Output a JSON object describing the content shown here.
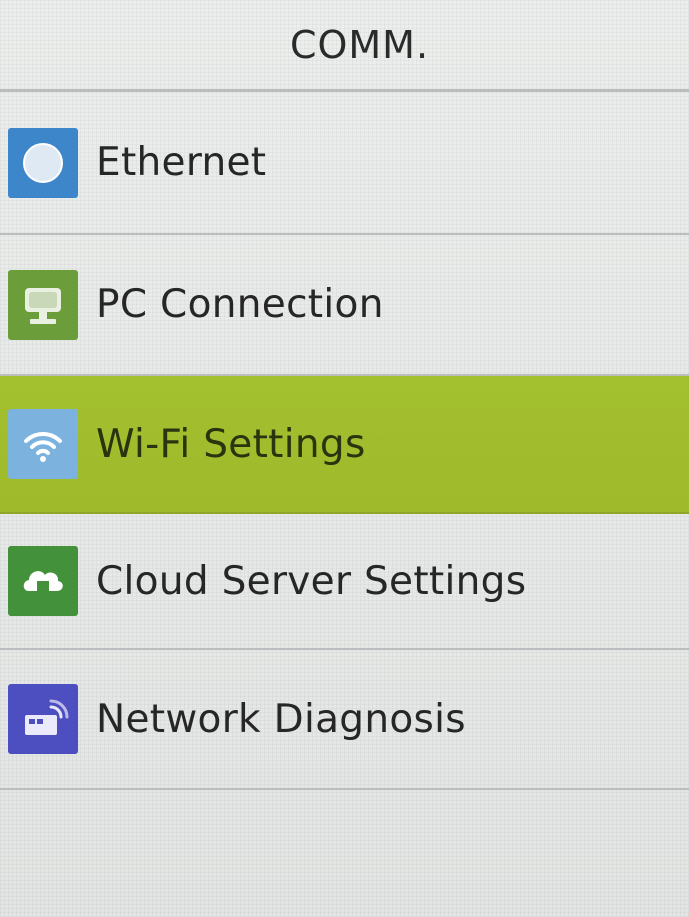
{
  "header": {
    "title": "COMM."
  },
  "menu": {
    "items": [
      {
        "label": "Ethernet",
        "icon": "ethernet-icon",
        "color": "#3d86c9",
        "selected": false
      },
      {
        "label": "PC Connection",
        "icon": "pc-connection-icon",
        "color": "#6c9d3b",
        "selected": false
      },
      {
        "label": "Wi-Fi Settings",
        "icon": "wifi-icon",
        "color": "#7bb2de",
        "selected": true
      },
      {
        "label": "Cloud Server Settings",
        "icon": "cloud-server-icon",
        "color": "#43913a",
        "selected": false
      },
      {
        "label": "Network Diagnosis",
        "icon": "network-diagnosis-icon",
        "color": "#4d4ec0",
        "selected": false
      }
    ]
  },
  "theme": {
    "selected_color": "#a3c02f",
    "background": "#e6e8e7",
    "divider": "#b9bdbd"
  }
}
